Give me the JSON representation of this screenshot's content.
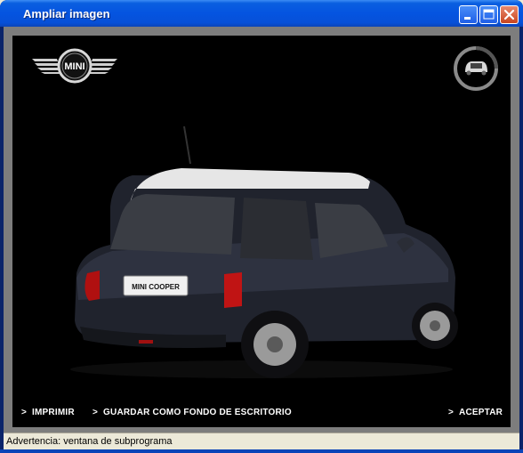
{
  "window": {
    "title": "Ampliar imagen"
  },
  "titlebar_buttons": {
    "minimize": "minimize-icon",
    "maximize": "maximize-icon",
    "close": "close-icon"
  },
  "viewer": {
    "logo_text": "MINI",
    "plate_text": "MINI COOPER",
    "rotate_icon": "rotate-view-icon",
    "actions": {
      "print": "IMPRIMIR",
      "wallpaper": "GUARDAR COMO FONDO DE ESCRITORIO",
      "accept": "ACEPTAR"
    }
  },
  "status": {
    "text": "Advertencia: ventana de subprograma"
  },
  "colors": {
    "titlebar": "#0554e0",
    "stage_bg": "#000000",
    "frame_gray": "#7d7d7d",
    "statusbar": "#ece9d8"
  }
}
